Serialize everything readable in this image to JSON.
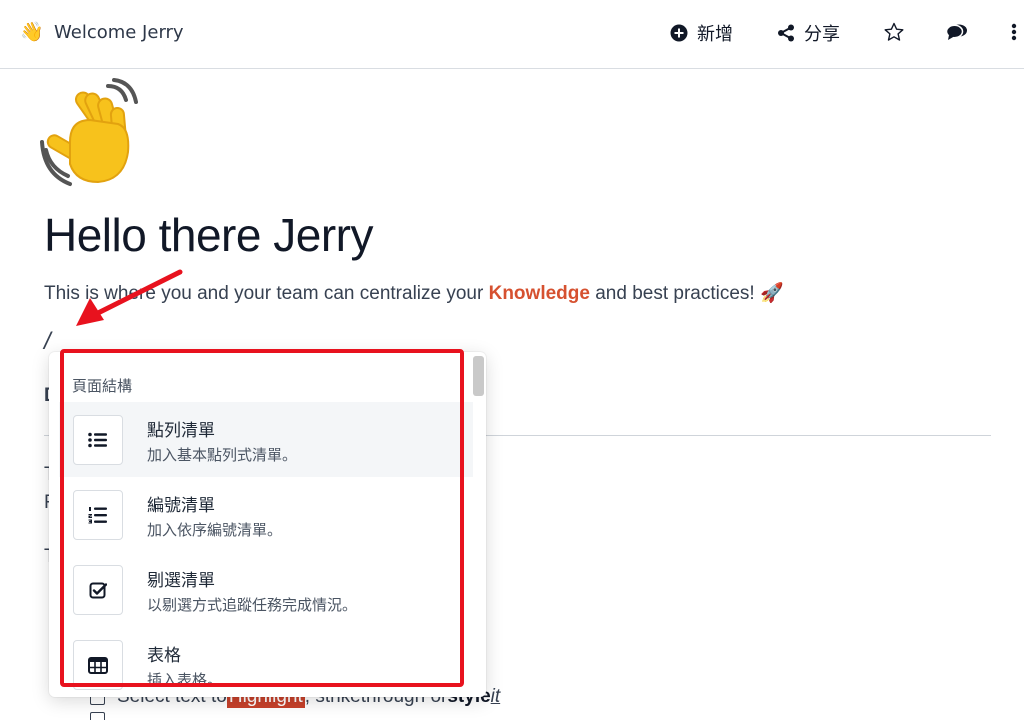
{
  "topbar": {
    "emoji": "👋",
    "title": "Welcome Jerry",
    "new_label": "新增",
    "share_label": "分享"
  },
  "doc": {
    "emoji": "waving-hand",
    "title": "Hello there Jerry",
    "intro_before": "This is where you and your team can centralize your ",
    "intro_accent": "Knowledge",
    "intro_after": " and best practices! 🚀",
    "slash_text": "/",
    "peek_letters": [
      "D",
      "T",
      "F",
      "T"
    ],
    "tasks": [
      {
        "before": "Select text to ",
        "highlight": "Highlight",
        "middle": ", strikethrough or ",
        "bold": "style",
        "space": " ",
        "italic": "it"
      }
    ]
  },
  "menu": {
    "header": "頁面結構",
    "items": [
      {
        "title": "點列清單",
        "desc": "加入基本點列式清單。",
        "icon": "bullet-list-icon"
      },
      {
        "title": "編號清單",
        "desc": "加入依序編號清單。",
        "icon": "numbered-list-icon"
      },
      {
        "title": "剔選清單",
        "desc": "以剔選方式追蹤任務完成情況。",
        "icon": "checkbox-icon"
      },
      {
        "title": "表格",
        "desc": "插入表格。",
        "icon": "table-icon"
      }
    ]
  },
  "colors": {
    "accent": "#d65130",
    "annotation": "#e8121e"
  }
}
